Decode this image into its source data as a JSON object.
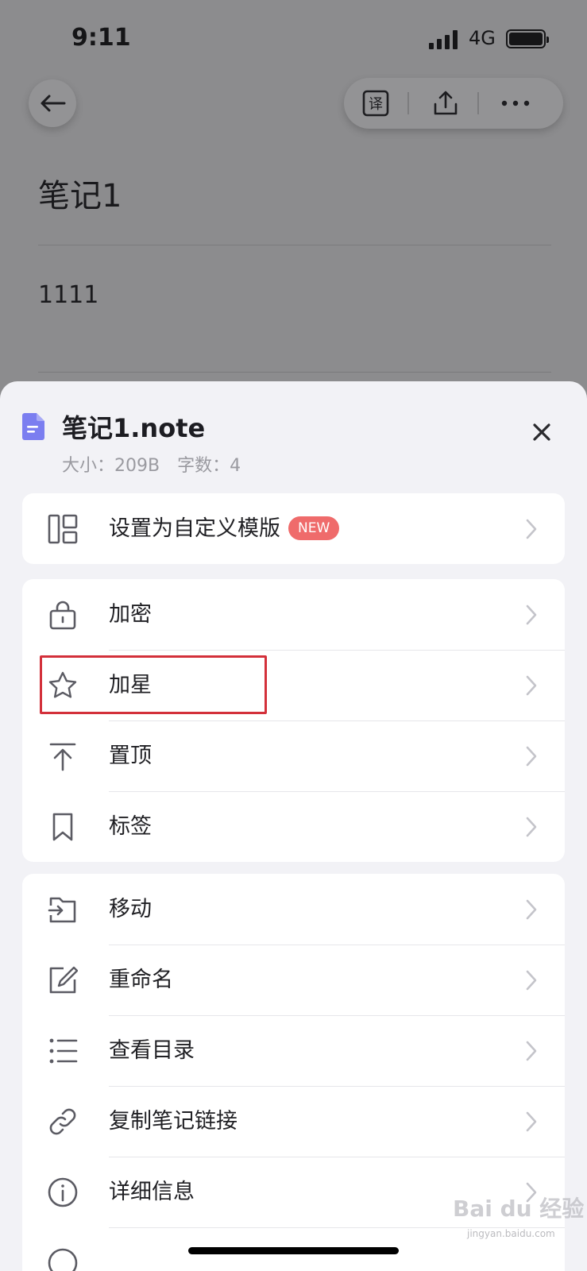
{
  "status_bar": {
    "time": "9:11",
    "network": "4G"
  },
  "note": {
    "title": "笔记1",
    "body": "1111"
  },
  "sheet": {
    "file_name": "笔记1.note",
    "size_text": "大小：209B",
    "word_count_text": "字数：4",
    "groups": [
      [
        {
          "icon": "layout-template-icon",
          "label": "设置为自定义模版",
          "badge": "NEW"
        }
      ],
      [
        {
          "icon": "lock-icon",
          "label": "加密"
        },
        {
          "icon": "star-icon",
          "label": "加星",
          "highlighted": true
        },
        {
          "icon": "pin-top-icon",
          "label": "置顶"
        },
        {
          "icon": "bookmark-icon",
          "label": "标签"
        }
      ],
      [
        {
          "icon": "folder-move-icon",
          "label": "移动"
        },
        {
          "icon": "edit-icon",
          "label": "重命名"
        },
        {
          "icon": "list-icon",
          "label": "查看目录"
        },
        {
          "icon": "link-icon",
          "label": "复制笔记链接"
        },
        {
          "icon": "info-icon",
          "label": "详细信息"
        }
      ]
    ]
  },
  "watermark": {
    "brand": "Bai du 经验",
    "sub": "jingyan.baidu.com"
  },
  "colors": {
    "accent_badge": "#ef6b6b",
    "highlight_box": "#d3303a",
    "file_icon": "#7b7ef0"
  }
}
